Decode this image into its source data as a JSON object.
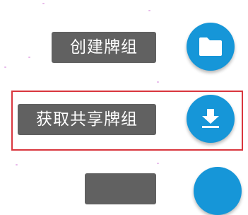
{
  "speed_dial": {
    "items": [
      {
        "label": "创建牌组",
        "icon": "folder-icon"
      },
      {
        "label": "获取共享牌组",
        "icon": "download-icon"
      },
      {
        "label": "",
        "icon": "add-icon"
      }
    ]
  },
  "colors": {
    "fab_background": "#1696d8",
    "label_background": "#616161",
    "label_text": "#ffffff",
    "highlight_border": "#d9363e"
  }
}
